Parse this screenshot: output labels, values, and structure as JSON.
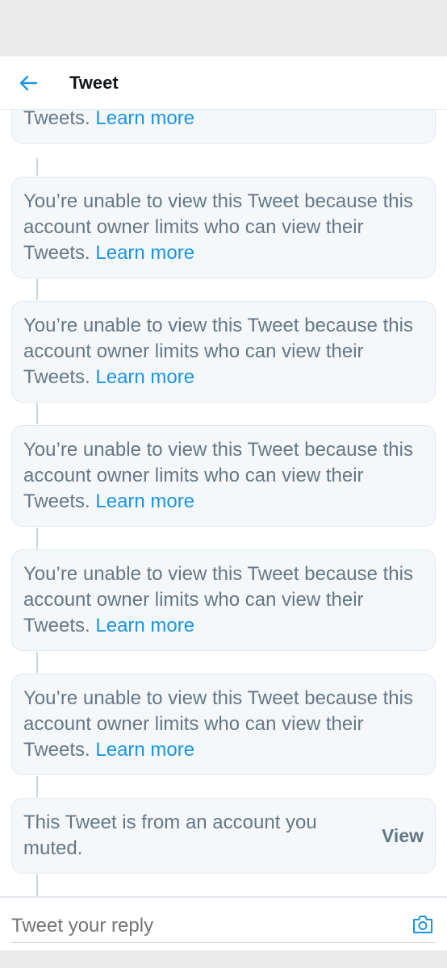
{
  "header": {
    "title": "Tweet",
    "back_icon": "arrow-left-icon",
    "accent": "#1b95e0"
  },
  "thread": {
    "items": [
      {
        "text": "You’re unable to view this Tweet because this account owner limits who can view their Tweets.",
        "link": "Learn more"
      },
      {
        "text": "You’re unable to view this Tweet because this account owner limits who can view their Tweets.",
        "link": "Learn more"
      },
      {
        "text": "You’re unable to view this Tweet because this account owner limits who can view their Tweets.",
        "link": "Learn more"
      },
      {
        "text": "You’re unable to view this Tweet because this account owner limits who can view their Tweets.",
        "link": "Learn more"
      },
      {
        "text": "You’re unable to view this Tweet because this account owner limits who can view their Tweets.",
        "link": "Learn more"
      },
      {
        "text": "You’re unable to view this Tweet because this account owner limits who can view their Tweets.",
        "link": "Learn more"
      }
    ],
    "muted": {
      "text": "This Tweet is from an account you muted.",
      "action": "View"
    }
  },
  "reply": {
    "placeholder": "Tweet your reply",
    "camera_icon": "camera-icon"
  }
}
